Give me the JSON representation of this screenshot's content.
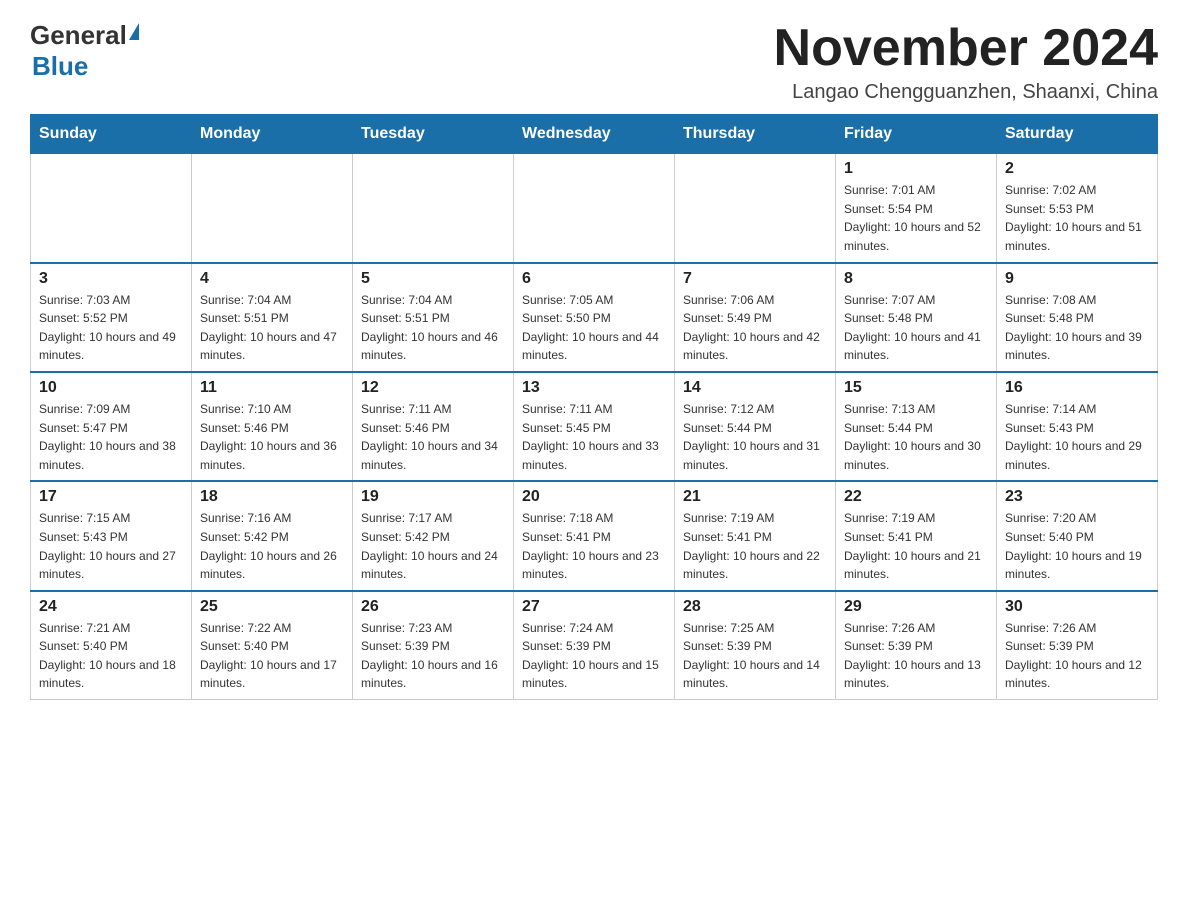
{
  "logo": {
    "text_general": "General",
    "text_blue": "Blue",
    "alt": "GeneralBlue logo"
  },
  "header": {
    "month_year": "November 2024",
    "location": "Langao Chengguanzhen, Shaanxi, China"
  },
  "days_of_week": [
    "Sunday",
    "Monday",
    "Tuesday",
    "Wednesday",
    "Thursday",
    "Friday",
    "Saturday"
  ],
  "weeks": [
    [
      {
        "day": "",
        "info": ""
      },
      {
        "day": "",
        "info": ""
      },
      {
        "day": "",
        "info": ""
      },
      {
        "day": "",
        "info": ""
      },
      {
        "day": "",
        "info": ""
      },
      {
        "day": "1",
        "info": "Sunrise: 7:01 AM\nSunset: 5:54 PM\nDaylight: 10 hours and 52 minutes."
      },
      {
        "day": "2",
        "info": "Sunrise: 7:02 AM\nSunset: 5:53 PM\nDaylight: 10 hours and 51 minutes."
      }
    ],
    [
      {
        "day": "3",
        "info": "Sunrise: 7:03 AM\nSunset: 5:52 PM\nDaylight: 10 hours and 49 minutes."
      },
      {
        "day": "4",
        "info": "Sunrise: 7:04 AM\nSunset: 5:51 PM\nDaylight: 10 hours and 47 minutes."
      },
      {
        "day": "5",
        "info": "Sunrise: 7:04 AM\nSunset: 5:51 PM\nDaylight: 10 hours and 46 minutes."
      },
      {
        "day": "6",
        "info": "Sunrise: 7:05 AM\nSunset: 5:50 PM\nDaylight: 10 hours and 44 minutes."
      },
      {
        "day": "7",
        "info": "Sunrise: 7:06 AM\nSunset: 5:49 PM\nDaylight: 10 hours and 42 minutes."
      },
      {
        "day": "8",
        "info": "Sunrise: 7:07 AM\nSunset: 5:48 PM\nDaylight: 10 hours and 41 minutes."
      },
      {
        "day": "9",
        "info": "Sunrise: 7:08 AM\nSunset: 5:48 PM\nDaylight: 10 hours and 39 minutes."
      }
    ],
    [
      {
        "day": "10",
        "info": "Sunrise: 7:09 AM\nSunset: 5:47 PM\nDaylight: 10 hours and 38 minutes."
      },
      {
        "day": "11",
        "info": "Sunrise: 7:10 AM\nSunset: 5:46 PM\nDaylight: 10 hours and 36 minutes."
      },
      {
        "day": "12",
        "info": "Sunrise: 7:11 AM\nSunset: 5:46 PM\nDaylight: 10 hours and 34 minutes."
      },
      {
        "day": "13",
        "info": "Sunrise: 7:11 AM\nSunset: 5:45 PM\nDaylight: 10 hours and 33 minutes."
      },
      {
        "day": "14",
        "info": "Sunrise: 7:12 AM\nSunset: 5:44 PM\nDaylight: 10 hours and 31 minutes."
      },
      {
        "day": "15",
        "info": "Sunrise: 7:13 AM\nSunset: 5:44 PM\nDaylight: 10 hours and 30 minutes."
      },
      {
        "day": "16",
        "info": "Sunrise: 7:14 AM\nSunset: 5:43 PM\nDaylight: 10 hours and 29 minutes."
      }
    ],
    [
      {
        "day": "17",
        "info": "Sunrise: 7:15 AM\nSunset: 5:43 PM\nDaylight: 10 hours and 27 minutes."
      },
      {
        "day": "18",
        "info": "Sunrise: 7:16 AM\nSunset: 5:42 PM\nDaylight: 10 hours and 26 minutes."
      },
      {
        "day": "19",
        "info": "Sunrise: 7:17 AM\nSunset: 5:42 PM\nDaylight: 10 hours and 24 minutes."
      },
      {
        "day": "20",
        "info": "Sunrise: 7:18 AM\nSunset: 5:41 PM\nDaylight: 10 hours and 23 minutes."
      },
      {
        "day": "21",
        "info": "Sunrise: 7:19 AM\nSunset: 5:41 PM\nDaylight: 10 hours and 22 minutes."
      },
      {
        "day": "22",
        "info": "Sunrise: 7:19 AM\nSunset: 5:41 PM\nDaylight: 10 hours and 21 minutes."
      },
      {
        "day": "23",
        "info": "Sunrise: 7:20 AM\nSunset: 5:40 PM\nDaylight: 10 hours and 19 minutes."
      }
    ],
    [
      {
        "day": "24",
        "info": "Sunrise: 7:21 AM\nSunset: 5:40 PM\nDaylight: 10 hours and 18 minutes."
      },
      {
        "day": "25",
        "info": "Sunrise: 7:22 AM\nSunset: 5:40 PM\nDaylight: 10 hours and 17 minutes."
      },
      {
        "day": "26",
        "info": "Sunrise: 7:23 AM\nSunset: 5:39 PM\nDaylight: 10 hours and 16 minutes."
      },
      {
        "day": "27",
        "info": "Sunrise: 7:24 AM\nSunset: 5:39 PM\nDaylight: 10 hours and 15 minutes."
      },
      {
        "day": "28",
        "info": "Sunrise: 7:25 AM\nSunset: 5:39 PM\nDaylight: 10 hours and 14 minutes."
      },
      {
        "day": "29",
        "info": "Sunrise: 7:26 AM\nSunset: 5:39 PM\nDaylight: 10 hours and 13 minutes."
      },
      {
        "day": "30",
        "info": "Sunrise: 7:26 AM\nSunset: 5:39 PM\nDaylight: 10 hours and 12 minutes."
      }
    ]
  ]
}
